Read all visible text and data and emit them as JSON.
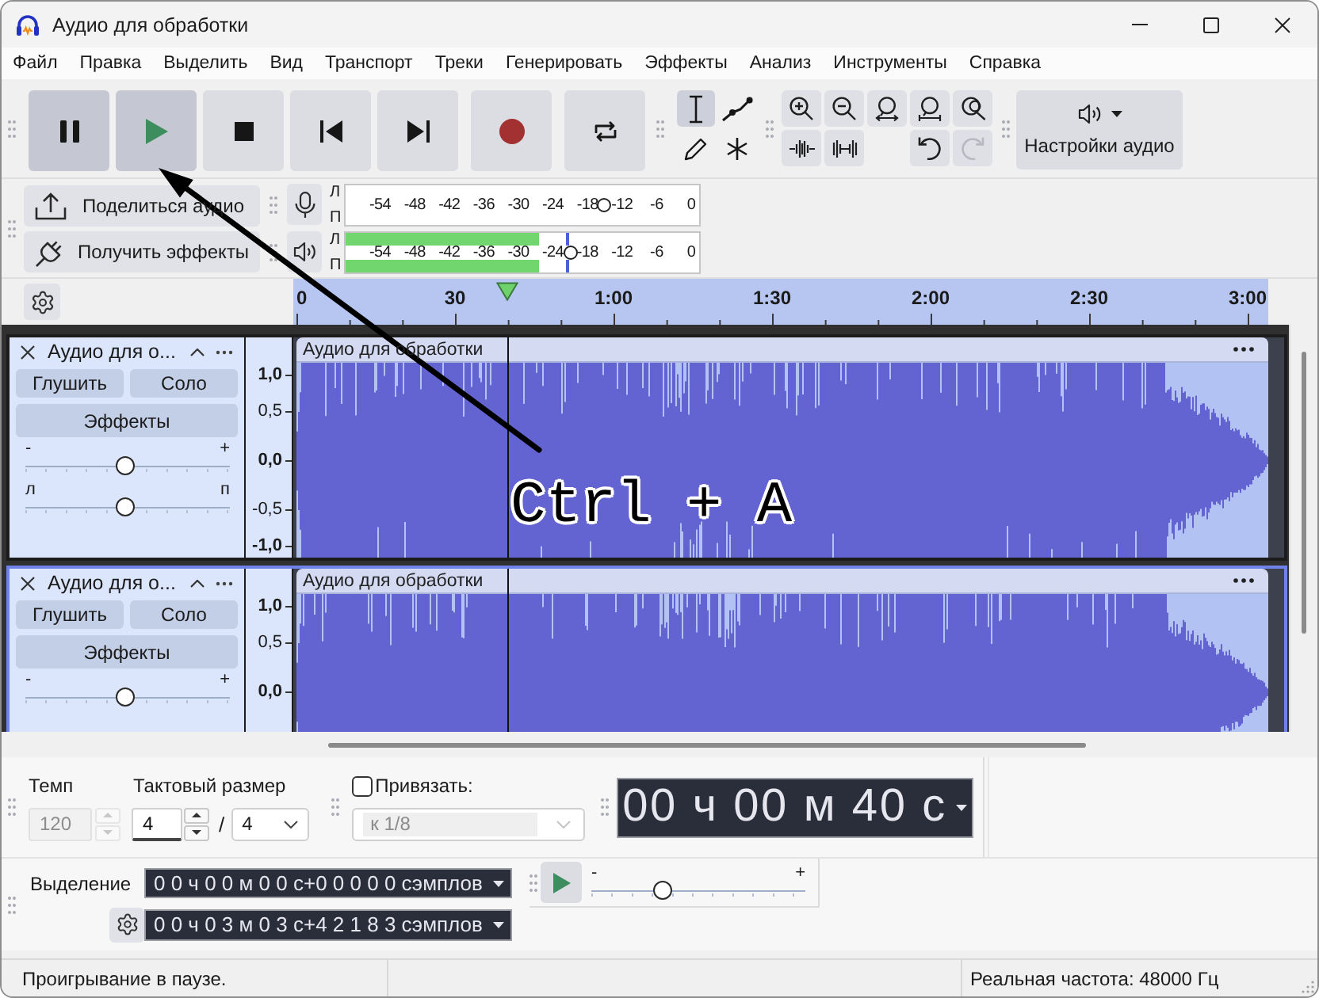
{
  "window": {
    "title": "Аудио для обработки"
  },
  "menu": [
    "Файл",
    "Правка",
    "Выделить",
    "Вид",
    "Транспорт",
    "Треки",
    "Генерировать",
    "Эффекты",
    "Анализ",
    "Инструменты",
    "Справка"
  ],
  "transport": [
    {
      "kind": "pause",
      "pressed": true
    },
    {
      "kind": "play",
      "pressed": true
    },
    {
      "kind": "stop",
      "pressed": false
    },
    {
      "kind": "skip-start",
      "pressed": false
    },
    {
      "kind": "skip-end",
      "pressed": false
    },
    {
      "kind": "record",
      "pressed": false
    },
    {
      "kind": "loop",
      "pressed": false
    }
  ],
  "tools": [
    {
      "kind": "select",
      "selected": true
    },
    {
      "kind": "envelope",
      "selected": false
    },
    {
      "kind": "draw",
      "selected": false
    },
    {
      "kind": "multi",
      "selected": false
    }
  ],
  "edit_tools": {
    "row_1": [
      {
        "kind": "zoom-in",
        "disabled": false
      },
      {
        "kind": "zoom-out",
        "disabled": false
      },
      {
        "kind": "fit-selection",
        "disabled": false
      },
      {
        "kind": "fit-project",
        "disabled": false
      },
      {
        "kind": "zoom-toggle",
        "disabled": false
      }
    ],
    "row_2": [
      {
        "kind": "trim",
        "disabled": false
      },
      {
        "kind": "silence",
        "disabled": false
      },
      {
        "kind": "undo",
        "disabled": false
      },
      {
        "kind": "redo",
        "disabled": true
      }
    ]
  },
  "audio_setup": {
    "label": "Настройки аудио"
  },
  "share_buttons": [
    {
      "kind": "share",
      "label": "Поделиться аудио"
    },
    {
      "kind": "effects",
      "label": "Получить эффекты"
    }
  ],
  "meters": [
    {
      "kind": "recording",
      "channels": [
        {
          "label": "Л"
        },
        {
          "label": "П"
        }
      ],
      "ticks": [
        "-54",
        "-48",
        "-42",
        "-36",
        "-30",
        "-24",
        "-18",
        "-12",
        "-6",
        "0"
      ],
      "slider": {
        "level": 0.733
      }
    },
    {
      "kind": "playback",
      "channels": [
        {
          "label": "Л",
          "level": 0.545,
          "peak": {
            "level": 0.623
          }
        },
        {
          "label": "П",
          "level": 0.545,
          "peak": {
            "level": 0.623
          }
        }
      ],
      "ticks": [
        "-54",
        "-48",
        "-42",
        "-36",
        "-30",
        "-24",
        "-18",
        "-12",
        "-6",
        "0"
      ],
      "slider": {
        "level": 0.635
      }
    }
  ],
  "ruler": {
    "labels": [
      "0",
      "30",
      "1:00",
      "1:30",
      "2:00",
      "2:30",
      "3:00"
    ],
    "selection": {
      "level": 0.984
    },
    "playhead": {
      "level": 0.213
    }
  },
  "tracks": [
    {
      "name": "Аудио для о...",
      "selected": true,
      "focused": false,
      "mute": "Глушить",
      "solo": "Соло",
      "effects": "Эффекты",
      "gain": {
        "minus": "-",
        "plus": "+",
        "level": 0.49
      },
      "pan": {
        "left": "л",
        "right": "п",
        "level": 0.49
      },
      "scale": [
        {
          "label": "1,0",
          "major": true
        },
        {
          "label": "0,5",
          "major": false
        },
        {
          "label": "0,0",
          "major": true
        },
        {
          "label": "-0,5",
          "major": false
        },
        {
          "label": "-1,0",
          "major": true
        }
      ],
      "clip_title": "Аудио для обработки"
    },
    {
      "name": "Аудио для о...",
      "selected": true,
      "focused": true,
      "mute": "Глушить",
      "solo": "Соло",
      "effects": "Эффекты",
      "gain": {
        "minus": "-",
        "plus": "+",
        "level": 0.49
      },
      "scale": [
        {
          "label": "1,0",
          "major": true
        },
        {
          "label": "0,5",
          "major": false
        },
        {
          "label": "0,0",
          "major": true
        }
      ],
      "clip_title": "Аудио для обработки"
    }
  ],
  "time_signature": {
    "tempo_label": "Темп",
    "tempo": {
      "value": "120",
      "disabled": true
    },
    "signature_label": "Тактовый размер",
    "upper": "4",
    "separator": "/",
    "lower": "4"
  },
  "snap": {
    "label": "Привязать:",
    "checked": false,
    "value": "к 1/8",
    "disabled": true
  },
  "time_display": {
    "value": "00 ч 00 м 40 с"
  },
  "selection": {
    "label": "Выделение",
    "start": "0 0 ч 0 0 м 0 0 с+0 0 0 0 0 сэмплов",
    "end": "0 0 ч 0 3 м 0 3 с+4 2 1 8 3 сэмплов"
  },
  "play_at_speed": {
    "minus": "-",
    "plus": "+",
    "level": 0.33
  },
  "status_bar": {
    "message": "Проигрывание в паузе.",
    "rate": "Реальная частота: 48000 Гц"
  },
  "annotation": {
    "text": "Ctrl + A"
  }
}
